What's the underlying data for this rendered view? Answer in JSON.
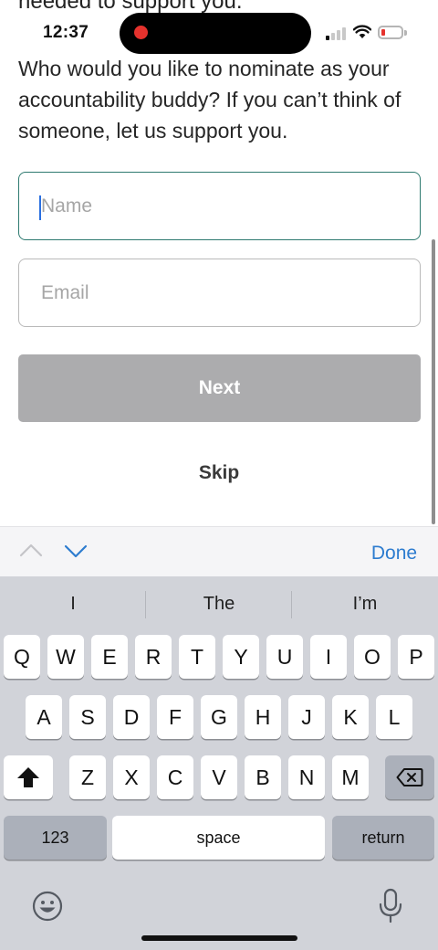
{
  "status_bar": {
    "time": "12:37"
  },
  "content": {
    "cut_text": "needed to support you.",
    "prompt": "Who would you like to nominate as your accountability buddy? If you can’t think of someone, let us support you.",
    "name_field": {
      "value": "",
      "placeholder": "Name"
    },
    "email_field": {
      "value": "",
      "placeholder": "Email"
    },
    "next_label": "Next",
    "skip_label": "Skip"
  },
  "accessory": {
    "done_label": "Done"
  },
  "keyboard": {
    "suggestions": [
      "I",
      "The",
      "I’m"
    ],
    "row1": [
      "Q",
      "W",
      "E",
      "R",
      "T",
      "Y",
      "U",
      "I",
      "O",
      "P"
    ],
    "row2": [
      "A",
      "S",
      "D",
      "F",
      "G",
      "H",
      "J",
      "K",
      "L"
    ],
    "row3": [
      "Z",
      "X",
      "C",
      "V",
      "B",
      "N",
      "M"
    ],
    "numbers_label": "123",
    "space_label": "space",
    "return_label": "return"
  },
  "colors": {
    "accent_teal": "#2e7a70",
    "button_disabled": "#acacae",
    "link_blue": "#2d7ccf",
    "record_red": "#e5322d"
  },
  "icons": [
    "signal-icon",
    "wifi-icon",
    "battery-icon",
    "chevron-up-icon",
    "chevron-down-icon",
    "shift-icon",
    "backspace-icon",
    "emoji-icon",
    "microphone-icon"
  ]
}
